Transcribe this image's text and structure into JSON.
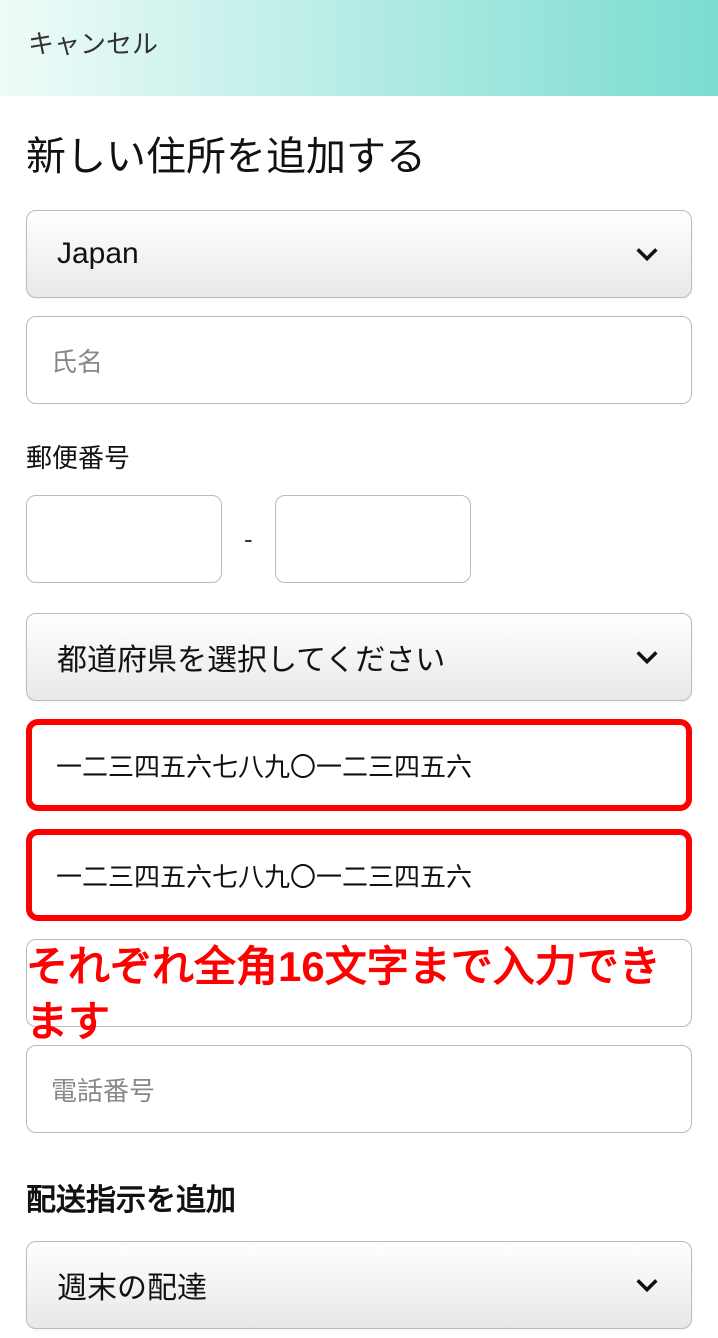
{
  "topbar": {
    "cancel": "キャンセル"
  },
  "page": {
    "title": "新しい住所を追加する"
  },
  "form": {
    "country_selected": "Japan",
    "name_placeholder": "氏名",
    "postal_label": "郵便番号",
    "postal_dash": "-",
    "prefecture_placeholder": "都道府県を選択してください",
    "address1_value": "一二三四五六七八九〇一二三四五六",
    "address2_value": "一二三四五六七八九〇一二三四五六",
    "phone_placeholder": "電話番号"
  },
  "annotation": {
    "text": "それぞれ全角16文字まで入力できます"
  },
  "delivery": {
    "section_title": "配送指示を追加",
    "weekend_label": "週末の配達"
  }
}
